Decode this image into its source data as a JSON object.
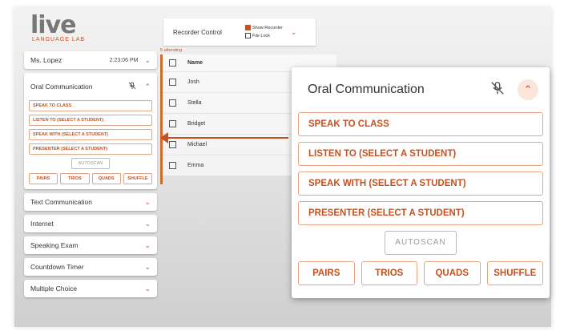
{
  "logo": {
    "main": "live",
    "sub": "LANGUAGE LAB"
  },
  "teacher": {
    "name": "Ms. Lopez",
    "time": "2:23:06 PM"
  },
  "oral_small": {
    "title": "Oral Communication",
    "buttons": [
      "SPEAK TO CLASS",
      "LISTEN TO (SELECT A STUDENT)",
      "SPEAK WITH (SELECT A STUDENT)",
      "PRESENTER (SELECT A STUDENT)"
    ],
    "autoscan": "AUTOSCAN",
    "group": [
      "PAIRS",
      "TRIOS",
      "QUADS",
      "SHUFFLE"
    ]
  },
  "menu": [
    "Text Communication",
    "Internet",
    "Speaking Exam",
    "Countdown Timer",
    "Multiple Choice"
  ],
  "recorder": {
    "title": "Recorder Control",
    "show_recorder": "Show Recorder",
    "file_lock": "File Lock"
  },
  "students": {
    "attending": "5 attending",
    "header": "Name",
    "names": [
      "Josh",
      "Stella",
      "Bridget",
      "Michael",
      "Emma"
    ]
  },
  "oral_big": {
    "title": "Oral Communication",
    "buttons": [
      "SPEAK TO CLASS",
      "LISTEN TO (SELECT A STUDENT)",
      "SPEAK WITH (SELECT A STUDENT)",
      "PRESENTER (SELECT A STUDENT)"
    ],
    "autoscan": "AUTOSCAN",
    "group": [
      "PAIRS",
      "TRIOS",
      "QUADS",
      "SHUFFLE"
    ]
  },
  "icons": {
    "mic_muted": "mic-muted-icon",
    "chevron_up": "chevron-up-icon",
    "chevron_down": "chevron-down-icon"
  },
  "colors": {
    "accent": "#c8501e"
  }
}
